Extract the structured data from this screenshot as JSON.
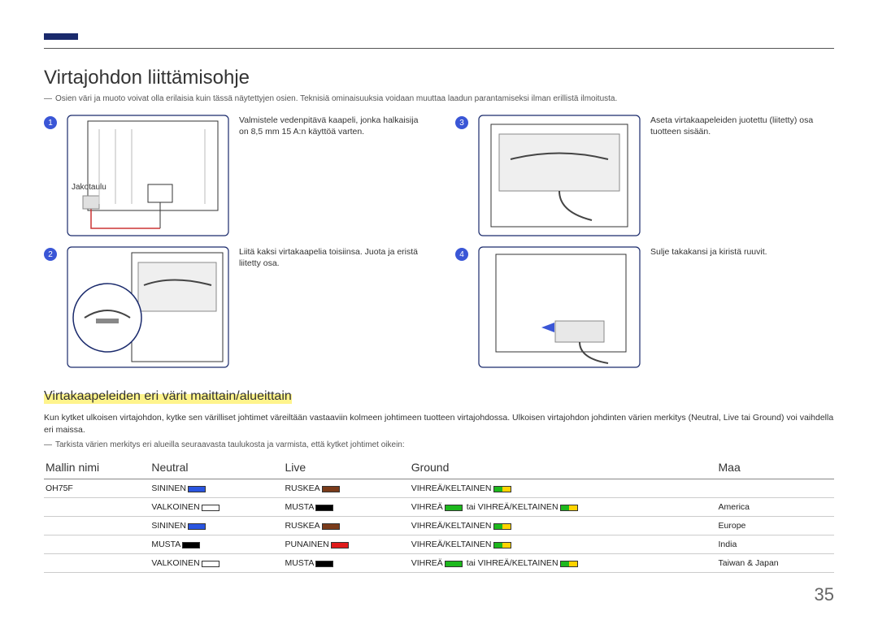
{
  "page_number": "35",
  "title": "Virtajohdon liittämisohje",
  "note_top": "Osien väri ja muoto voivat olla erilaisia kuin tässä näytettyjen osien. Teknisiä ominaisuuksia voidaan muuttaa laadun parantamiseksi ilman erillistä ilmoitusta.",
  "steps": {
    "s1_text": "Valmistele vedenpitävä kaapeli, jonka halkaisija on 8,5 mm 15 A:n käyttöä varten.",
    "s1_label": "Jakotaulu",
    "s2_text": "Liitä kaksi virtakaapelia toisiinsa. Juota ja eristä liitetty osa.",
    "s3_text": "Aseta virtakaapeleiden juotettu (liitetty) osa tuotteen sisään.",
    "s4_text": "Sulje takakansi ja kiristä ruuvit."
  },
  "section_title": "Virtakaapeleiden eri värit maittain/alueittain",
  "section_body": "Kun kytket ulkoisen virtajohdon, kytke sen värilliset johtimet väreiltään vastaaviin kolmeen johtimeen tuotteen virtajohdossa. Ulkoisen virtajohdon johdinten värien merkitys (Neutral, Live tai Ground) voi vaihdella eri maissa.",
  "section_note": "Tarkista värien merkitys eri alueilla seuraavasta taulukosta ja varmista, että kytket johtimet oikein:",
  "table": {
    "headers": {
      "model": "Mallin nimi",
      "neutral": "Neutral",
      "live": "Live",
      "ground": "Ground",
      "country": "Maa"
    },
    "tai": "tai",
    "rows": [
      {
        "model": "OH75F",
        "neutral_label": "SININEN",
        "live_label": "RUSKEA",
        "ground_label": "VIHREÄ/KELTAINEN",
        "country": ""
      },
      {
        "model": "",
        "neutral_label": "VALKOINEN",
        "live_label": "MUSTA",
        "ground_label": "VIHREÄ",
        "ground_label2": "VIHREÄ/KELTAINEN",
        "country": "America"
      },
      {
        "model": "",
        "neutral_label": "SININEN",
        "live_label": "RUSKEA",
        "ground_label": "VIHREÄ/KELTAINEN",
        "country": "Europe"
      },
      {
        "model": "",
        "neutral_label": "MUSTA",
        "live_label": "PUNAINEN",
        "ground_label": "VIHREÄ/KELTAINEN",
        "country": "India"
      },
      {
        "model": "",
        "neutral_label": "VALKOINEN",
        "live_label": "MUSTA",
        "ground_label": "VIHREÄ",
        "ground_label2": "VIHREÄ/KELTAINEN",
        "country": "Taiwan & Japan"
      }
    ]
  }
}
